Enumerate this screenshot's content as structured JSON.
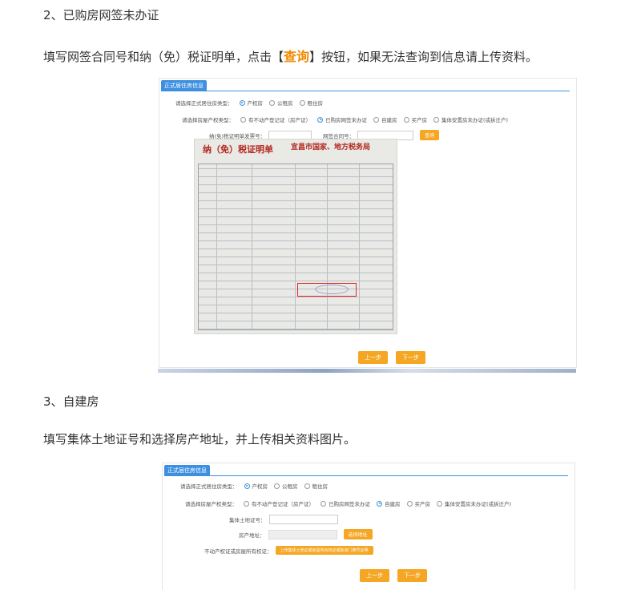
{
  "section2": {
    "heading": "2、已购房网签未办证",
    "desc_before": "填写网签合同号和纳（免）税证明单，点击【",
    "desc_highlight": "查询",
    "desc_after": "】按钮，如果无法查询到信息请上传资料。"
  },
  "section3": {
    "heading": "3、自建房",
    "desc": "填写集体土地证号和选择房产地址，并上传相关资料图片。"
  },
  "shot1": {
    "tag": "正式居住房信息",
    "row1_label": "请选择正式居住房类型：",
    "row1_options": [
      "产权房",
      "公租房",
      "租住房"
    ],
    "row2_label": "请选择房屋产权类型：",
    "row2_options": [
      "有不动产登记证（房产证）",
      "已购房网签未办证",
      "自建房",
      "买产房",
      "集体安置房未办证(或拆迁户)"
    ],
    "field1_label": "纳(免)税证明单发票号：",
    "field2_label": "网签合同号：",
    "query_btn": "查询",
    "doc_title": "纳（免）税证明单",
    "doc_org": "宜昌市国家、地方税务局",
    "prev": "上一步",
    "next": "下一步"
  },
  "shot2": {
    "tag": "正式居住房信息",
    "row1_label": "请选择正式居住房类型：",
    "row1_options": [
      "产权房",
      "公租房",
      "租住房"
    ],
    "row2_label": "请选择房屋产权类型：",
    "row2_options": [
      "有不动产登记证（房产证）",
      "已购房网签未办证",
      "自建房",
      "买产房",
      "集体安置房未办证(或拆迁户)"
    ],
    "land_label": "集体土地证号：",
    "address_label": "房产地址：",
    "address_btn": "选择地址",
    "upload_label": "不动产权证或房屋所有权证：",
    "upload_btn": "上传集体土地证或房屋所有权证或街道门牌号证明",
    "prev": "上一步",
    "next": "下一步"
  }
}
